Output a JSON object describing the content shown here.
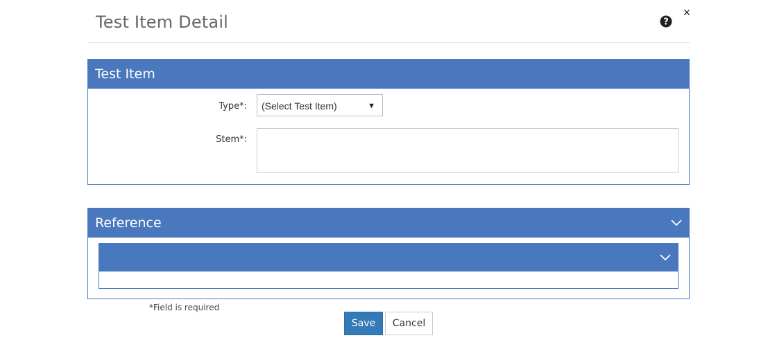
{
  "modal": {
    "title": "Test Item Detail",
    "help_icon": "question-circle-icon",
    "close_icon": "close-icon",
    "close_glyph": "×"
  },
  "test_item_panel": {
    "title": "Test Item",
    "type_label": "Type*:",
    "type_value": "(Select Test Item)",
    "stem_label": "Stem*:",
    "stem_value": ""
  },
  "reference_panel": {
    "title": "Reference",
    "inner_title": ""
  },
  "footer": {
    "required_note": "*Field is required",
    "save_label": "Save",
    "cancel_label": "Cancel"
  },
  "colors": {
    "panel_header": "#4a78be",
    "save_button": "#337ab7"
  }
}
